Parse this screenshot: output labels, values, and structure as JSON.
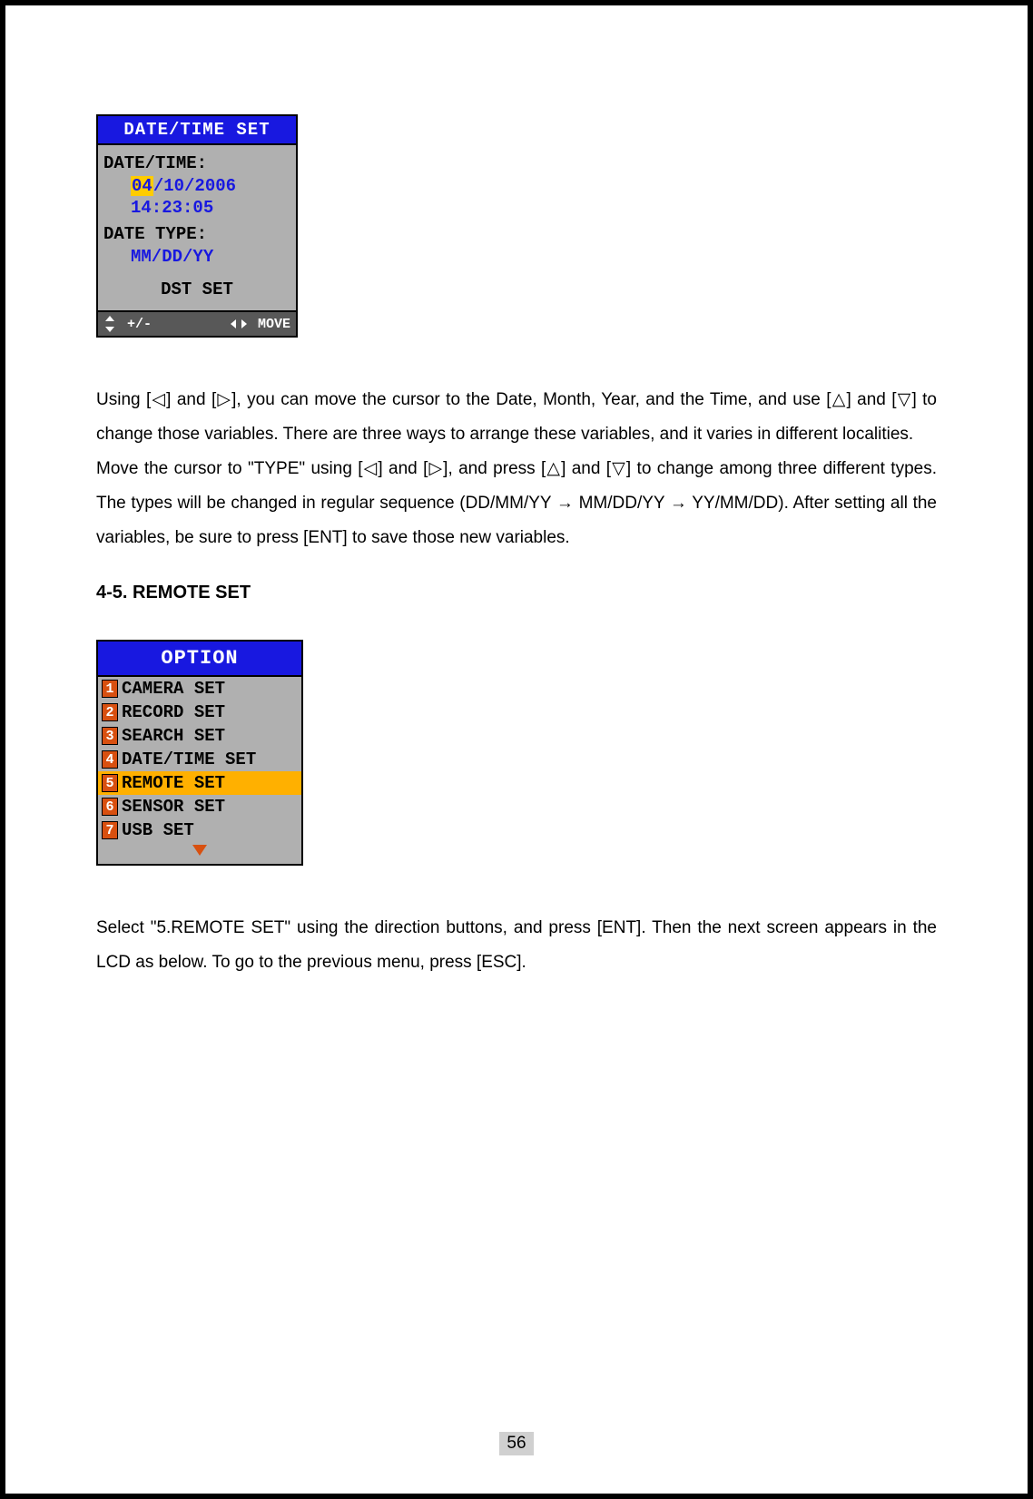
{
  "screen1": {
    "title": "DATE/TIME SET",
    "date_label": "DATE/TIME:",
    "date_day": "04",
    "date_rest": "/10/2006",
    "time_value": "14:23:05",
    "type_label": "DATE TYPE:",
    "type_value": "MM/DD/YY",
    "dst_label": "DST SET",
    "footer_left": "+/-",
    "footer_right": "MOVE"
  },
  "paragraph1": "Using [◁] and [▷], you can move the cursor to the Date, Month, Year, and the Time, and use [△] and [▽] to change those variables. There are three ways to arrange these variables, and it varies in different localities.",
  "paragraph1b": "Move the cursor to \"TYPE\" using [◁] and [▷], and press [△] and [▽] to change among three different types. The types will be changed in regular sequence (DD/MM/YY → MM/DD/YY → YY/MM/DD). After setting all the variables, be sure to press [ENT] to save those new variables.",
  "heading": "4-5. REMOTE SET",
  "screen2": {
    "title": "OPTION",
    "items": [
      {
        "num": "1",
        "label": "CAMERA SET"
      },
      {
        "num": "2",
        "label": "RECORD SET"
      },
      {
        "num": "3",
        "label": "SEARCH SET"
      },
      {
        "num": "4",
        "label": "DATE/TIME SET"
      },
      {
        "num": "5",
        "label": "REMOTE SET"
      },
      {
        "num": "6",
        "label": "SENSOR SET"
      },
      {
        "num": "7",
        "label": "USB SET"
      }
    ],
    "selected_index": 4
  },
  "paragraph2": "Select \"5.REMOTE SET\" using the direction buttons, and press [ENT]. Then the next screen appears in the LCD as below. To go to the previous menu, press [ESC].",
  "page_number": "56"
}
